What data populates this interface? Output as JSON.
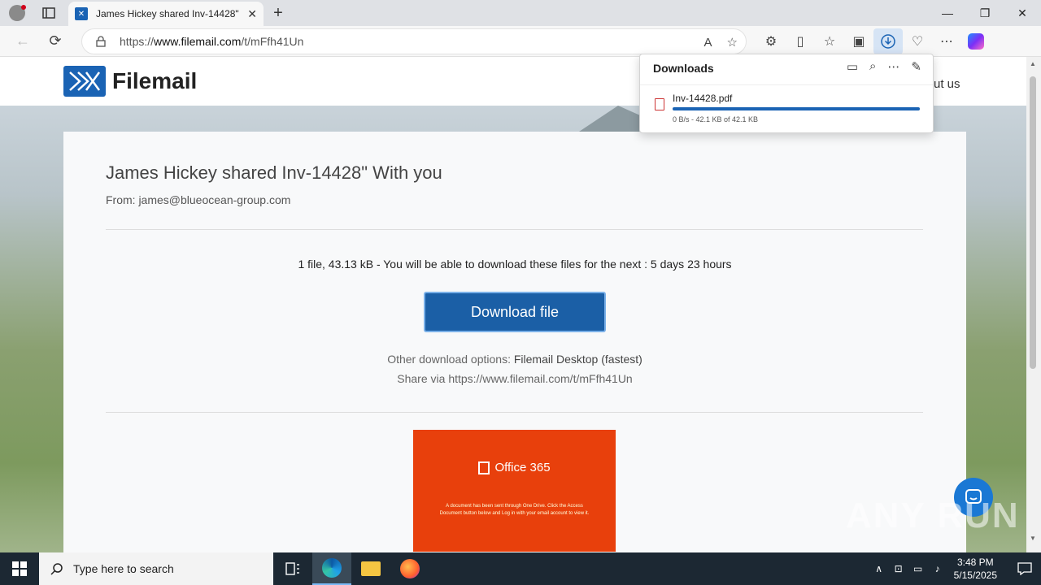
{
  "browser": {
    "tab_title": "James Hickey shared Inv-14428\"",
    "new_tab": "+",
    "url_prefix": "https://",
    "url_host": "www.filemail.com",
    "url_path": "/t/mFfh41Un",
    "minimize": "—",
    "maximize": "❐",
    "close": "✕"
  },
  "downloads": {
    "title": "Downloads",
    "file_name": "Inv-14428.pdf",
    "progress_text": "0 B/s - 42.1 KB of 42.1 KB",
    "progress_fraction": 1.0
  },
  "page": {
    "logo_text": "Filemail",
    "about_us": "ut us",
    "heading": "James Hickey shared Inv-14428\" With you",
    "from": "From: james@blueocean-group.com",
    "file_info": "1 file, 43.13 kB - You will be able to download these files for the next : 5 days 23 hours",
    "download_button": "Download file",
    "other_options_prefix": "Other download options: ",
    "other_options_link": "Filemail Desktop (fastest)",
    "share_prefix": "Share via ",
    "share_link": "https://www.filemail.com/t/mFfh41Un",
    "promo_title": "Office 365",
    "promo_text": "A document has been sent through One Drive. Click the Access Document button below and Log in with your email account to view it.",
    "watermark": "ANY RUN"
  },
  "taskbar": {
    "search_placeholder": "Type here to search",
    "time": "3:48 PM",
    "date": "5/15/2025"
  },
  "colors": {
    "brand_blue": "#1a63b4",
    "download_button": "#1b5fa6",
    "promo_orange": "#e8400c"
  }
}
